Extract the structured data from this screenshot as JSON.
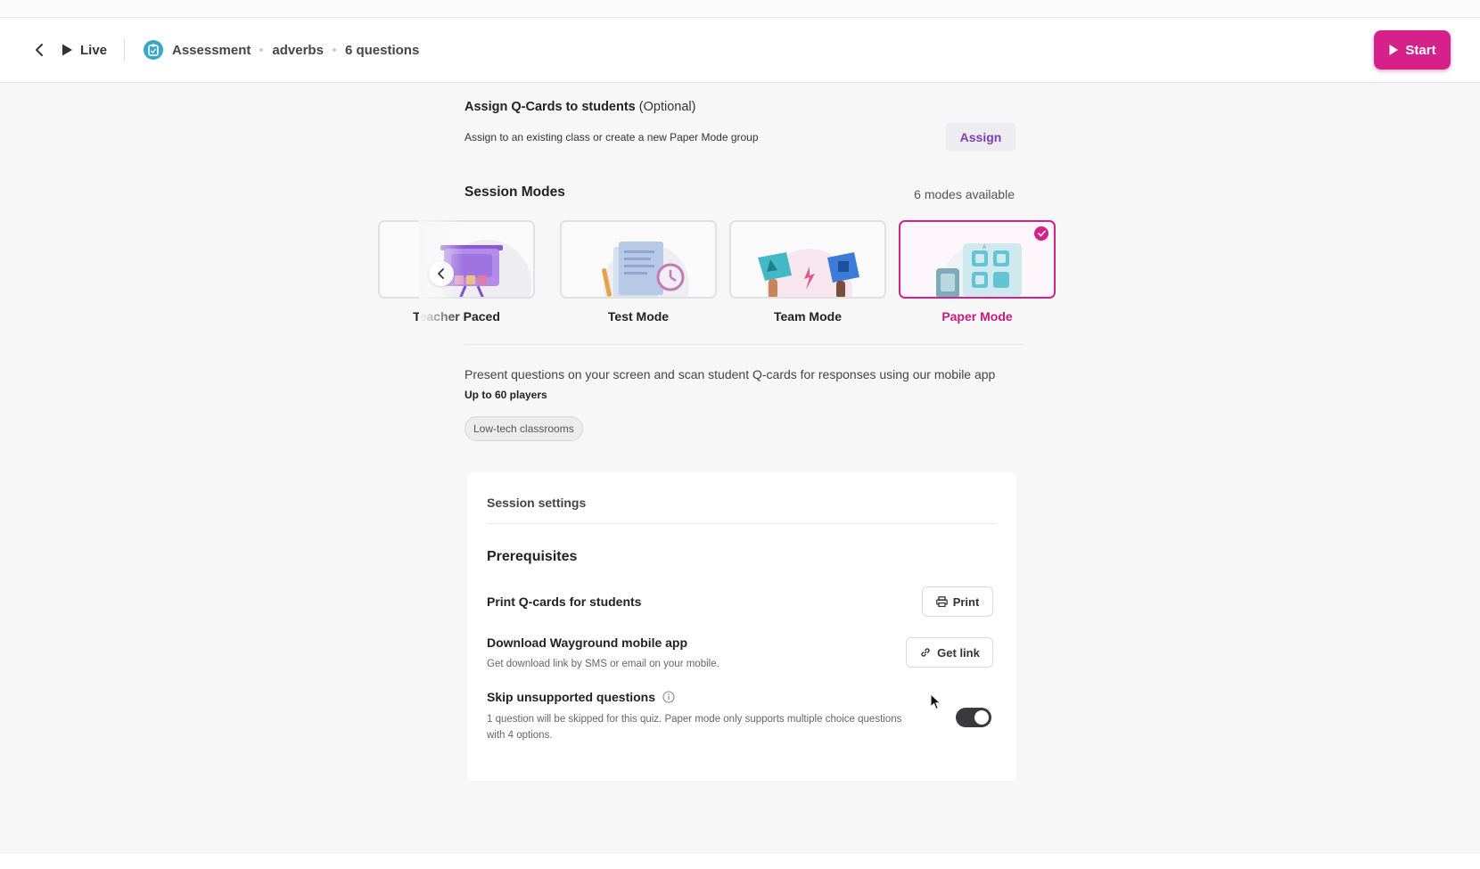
{
  "header": {
    "back_icon": "chevron-left-icon",
    "live_label": "Live",
    "crumbs": {
      "type": "Assessment",
      "topic": "adverbs",
      "count": "6 questions"
    },
    "start_label": "Start",
    "accent_color": "#d6218a"
  },
  "assign": {
    "title": "Assign Q-Cards to students",
    "optional": "(Optional)",
    "description": "Assign to an existing class or create a new Paper Mode group",
    "button": "Assign"
  },
  "session_modes": {
    "title": "Session Modes",
    "count": "6 modes available",
    "modes": [
      {
        "label": "Teacher Paced",
        "selected": false
      },
      {
        "label": "Test Mode",
        "selected": false
      },
      {
        "label": "Team Mode",
        "selected": false
      },
      {
        "label": "Paper Mode",
        "selected": true
      }
    ]
  },
  "mode_details": {
    "description": "Present questions on your screen and scan student Q-cards for responses using our mobile app",
    "players": "Up to 60 players",
    "tag": "Low-tech classrooms"
  },
  "settings": {
    "title": "Session settings",
    "prerequisites": "Prerequisites",
    "print_row": {
      "title": "Print Q-cards for students",
      "button": "Print"
    },
    "app_row": {
      "title": "Download Wayground mobile app",
      "subtitle": "Get download link by SMS or email on your mobile.",
      "button": "Get link"
    },
    "skip_row": {
      "title": "Skip unsupported questions",
      "subtitle_line1": "1 question will be skipped for this quiz. Paper mode only supports multiple choice questions",
      "subtitle_line2": "with 4 options.",
      "toggle_on": true
    }
  }
}
